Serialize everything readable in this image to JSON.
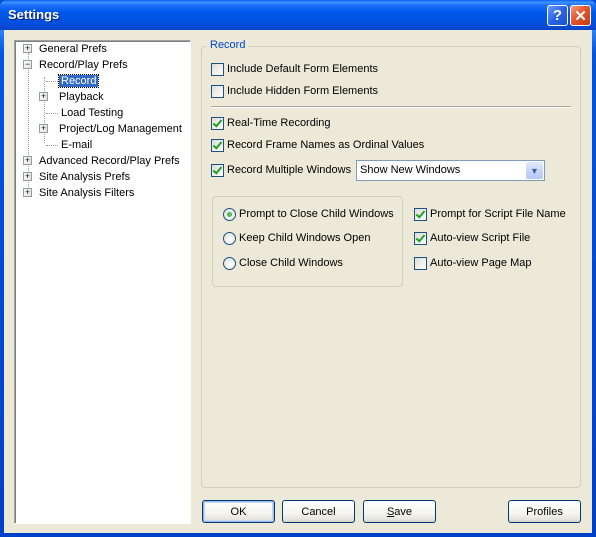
{
  "window": {
    "title": "Settings",
    "help_label": "?",
    "close_label": "✕",
    "icons": {
      "help": "help-icon",
      "close": "close-icon"
    }
  },
  "tree": {
    "items": [
      {
        "label": "General Prefs",
        "level": 0,
        "expander": "+"
      },
      {
        "label": "Record/Play Prefs",
        "level": 0,
        "expander": "-"
      },
      {
        "label": "Record",
        "level": 1,
        "expander": null,
        "selected": true
      },
      {
        "label": "Playback",
        "level": 1,
        "expander": "+"
      },
      {
        "label": "Load Testing",
        "level": 1,
        "expander": null
      },
      {
        "label": "Project/Log Management",
        "level": 1,
        "expander": "+"
      },
      {
        "label": "E-mail",
        "level": 1,
        "expander": null
      },
      {
        "label": "Advanced Record/Play Prefs",
        "level": 0,
        "expander": "+"
      },
      {
        "label": "Site Analysis Prefs",
        "level": 0,
        "expander": "+"
      },
      {
        "label": "Site Analysis Filters",
        "level": 0,
        "expander": "+"
      }
    ]
  },
  "panel": {
    "group_title": "Record",
    "checkboxes": [
      {
        "label": "Include Default Form Elements",
        "checked": false
      },
      {
        "label": "Include Hidden Form Elements",
        "checked": false
      },
      {
        "label": "Real-Time Recording",
        "checked": true
      },
      {
        "label": "Record Frame Names as Ordinal Values",
        "checked": true
      },
      {
        "label": "Record Multiple Windows",
        "checked": true
      }
    ],
    "multiple_windows_select": {
      "value": "Show New Windows"
    },
    "child_window_radios": [
      {
        "label": "Prompt to Close Child Windows",
        "checked": true
      },
      {
        "label": "Keep Child Windows Open",
        "checked": false
      },
      {
        "label": "Close Child Windows",
        "checked": false
      }
    ],
    "script_checkboxes": [
      {
        "label": "Prompt for Script File Name",
        "checked": true
      },
      {
        "label": "Auto-view Script File",
        "checked": true
      },
      {
        "label": "Auto-view Page Map",
        "checked": false
      }
    ]
  },
  "buttons": {
    "ok": "OK",
    "cancel": "Cancel",
    "save_prefix": "S",
    "save_rest": "ave",
    "profiles": "Profiles"
  }
}
